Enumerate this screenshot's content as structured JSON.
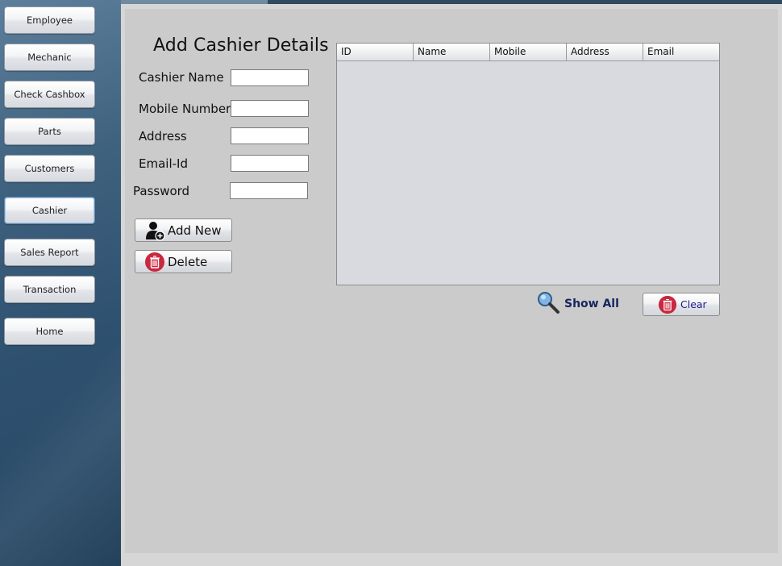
{
  "sidebar": {
    "items": [
      {
        "label": "Employee"
      },
      {
        "label": "Mechanic"
      },
      {
        "label": "Check Cashbox"
      },
      {
        "label": "Parts"
      },
      {
        "label": "Customers"
      },
      {
        "label": "Cashier"
      },
      {
        "label": "Sales Report"
      },
      {
        "label": "Transaction"
      },
      {
        "label": "Home"
      }
    ],
    "selected": "Cashier"
  },
  "form": {
    "title": "Add Cashier Details",
    "fields": [
      {
        "label": "Cashier Name",
        "value": ""
      },
      {
        "label": "Mobile Number",
        "value": ""
      },
      {
        "label": "Address",
        "value": ""
      },
      {
        "label": "Email-Id",
        "value": ""
      },
      {
        "label": "Password",
        "value": ""
      }
    ],
    "add_new_label": "Add New",
    "delete_label": "Delete"
  },
  "table": {
    "columns": [
      "ID",
      "Name",
      "Mobile",
      "Address",
      "Email"
    ],
    "rows": []
  },
  "show_all_label": "Show All",
  "clear_label": "Clear",
  "colors": {
    "delete_icon": "#c9283f",
    "show_all_text": "#16245e",
    "clear_text": "#1d1a8c"
  }
}
